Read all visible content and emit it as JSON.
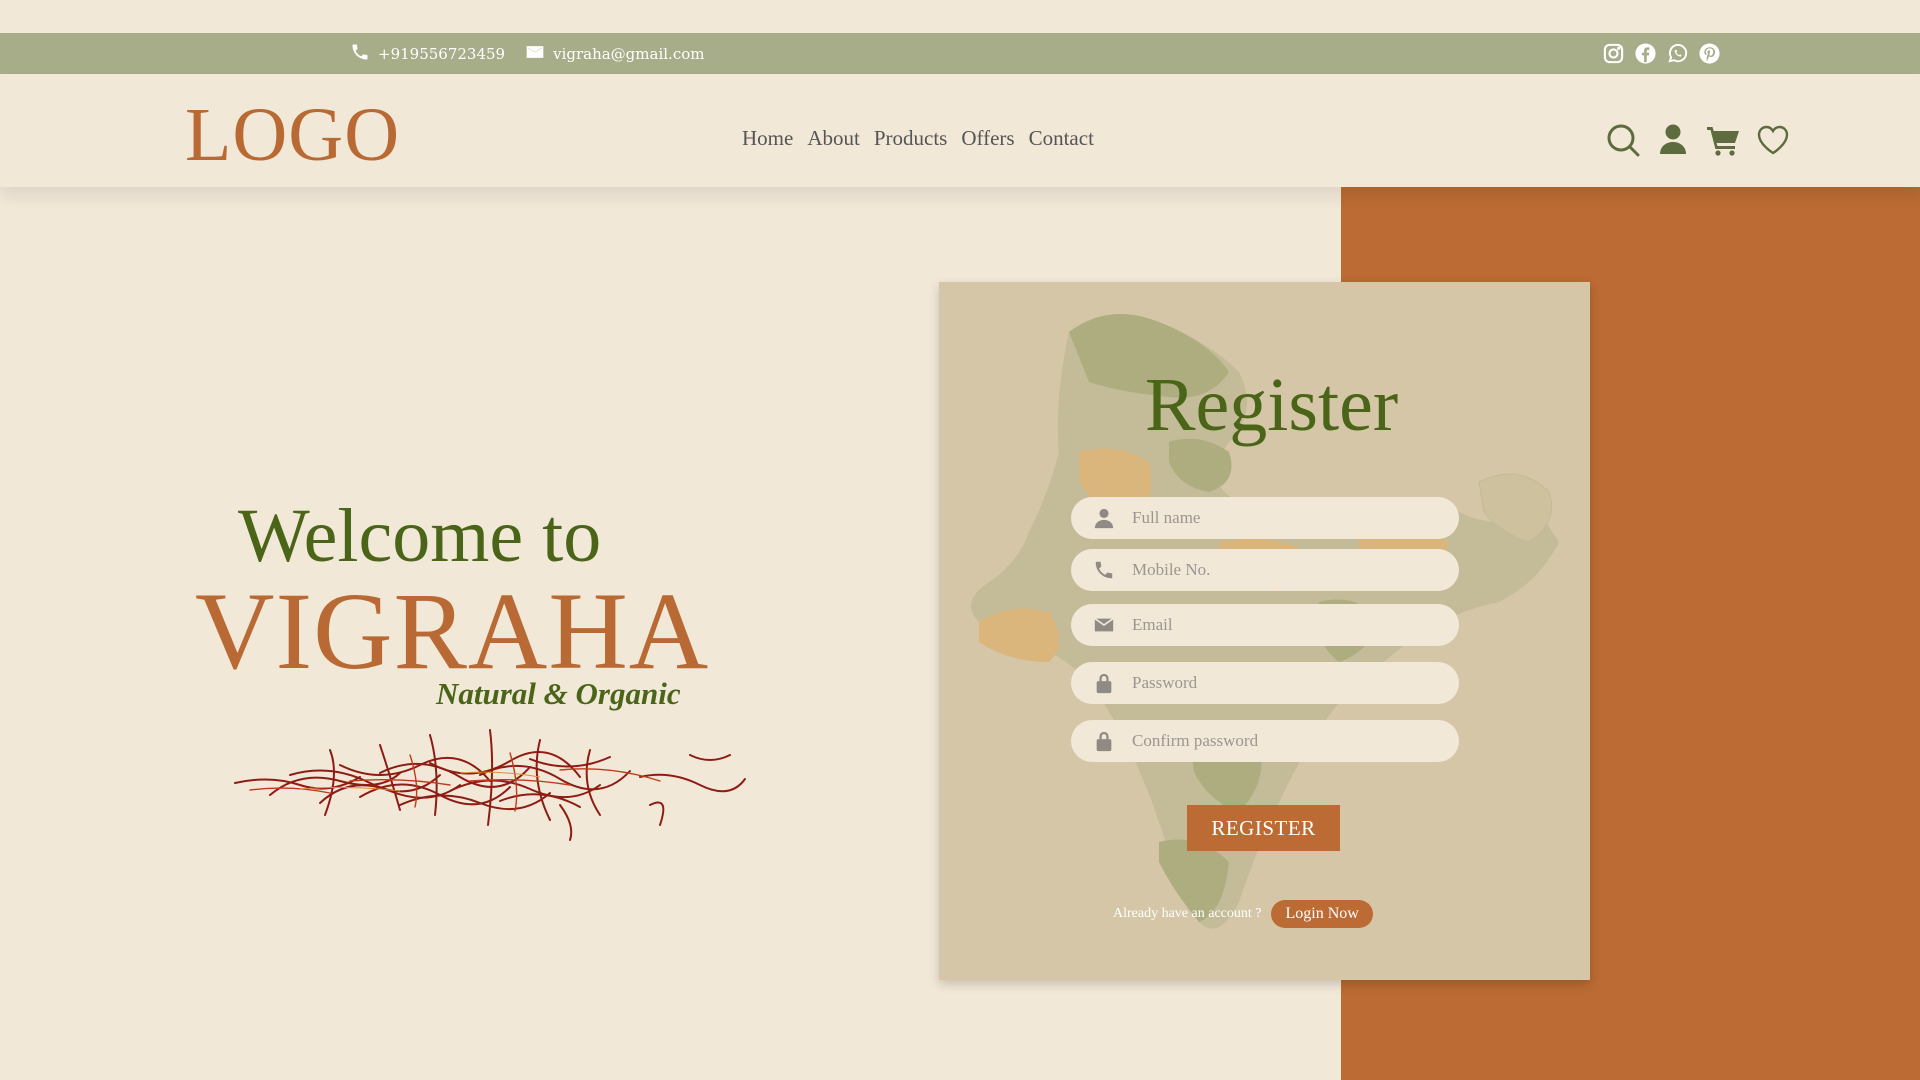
{
  "topbar": {
    "phone": "+919556723459",
    "email": "vigraha@gmail.com",
    "social": [
      "instagram-icon",
      "facebook-icon",
      "whatsapp-icon",
      "pinterest-icon"
    ]
  },
  "header": {
    "logo": "LOGO",
    "nav": [
      "Home",
      "About",
      "Products",
      "Offers",
      "Contact"
    ],
    "icons": [
      "search-icon",
      "user-icon",
      "cart-icon",
      "heart-icon"
    ]
  },
  "hero": {
    "welcome": "Welcome to",
    "brand": "VIGRAHA",
    "tagline": "Natural & Organic"
  },
  "register": {
    "title": "Register",
    "fields": [
      {
        "placeholder": "Full name",
        "icon": "user-icon"
      },
      {
        "placeholder": "Mobile No.",
        "icon": "phone-icon"
      },
      {
        "placeholder": "Email",
        "icon": "mail-icon"
      },
      {
        "placeholder": "Password",
        "icon": "lock-icon"
      },
      {
        "placeholder": "Confirm password",
        "icon": "lock-icon"
      }
    ],
    "button": "REGISTER",
    "login_prompt": "Already have an account ?",
    "login_button": "Login Now"
  },
  "colors": {
    "background": "#f2e8d8",
    "topbar": "#a8ad89",
    "accent_orange": "#bb6b33",
    "accent_green": "#4a6418",
    "card": "#d4c6a7"
  }
}
